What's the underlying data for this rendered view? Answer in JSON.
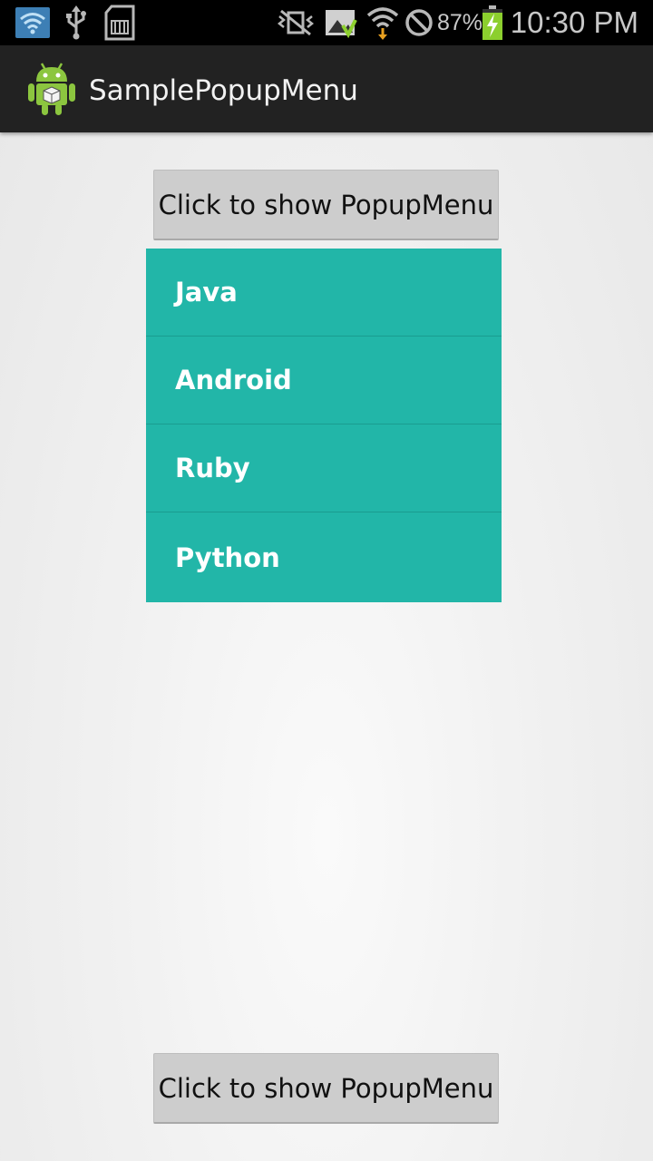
{
  "status_bar": {
    "battery_percent": "87%",
    "time": "10:30 PM",
    "icons": [
      "wifi-icon",
      "usb-icon",
      "sd-card-icon",
      "vibrate-icon",
      "gallery-icon",
      "wifi-signal-icon",
      "blocked-icon",
      "battery-charging-icon"
    ]
  },
  "action_bar": {
    "app_icon": "android-icon",
    "title": "SamplePopupMenu"
  },
  "main": {
    "top_button_label": "Click to show PopupMenu",
    "bottom_button_label": "Click to show PopupMenu"
  },
  "popup_menu": {
    "background": "#22b6a8",
    "items": [
      {
        "label": "Java"
      },
      {
        "label": "Android"
      },
      {
        "label": "Ruby"
      },
      {
        "label": "Python"
      }
    ]
  }
}
